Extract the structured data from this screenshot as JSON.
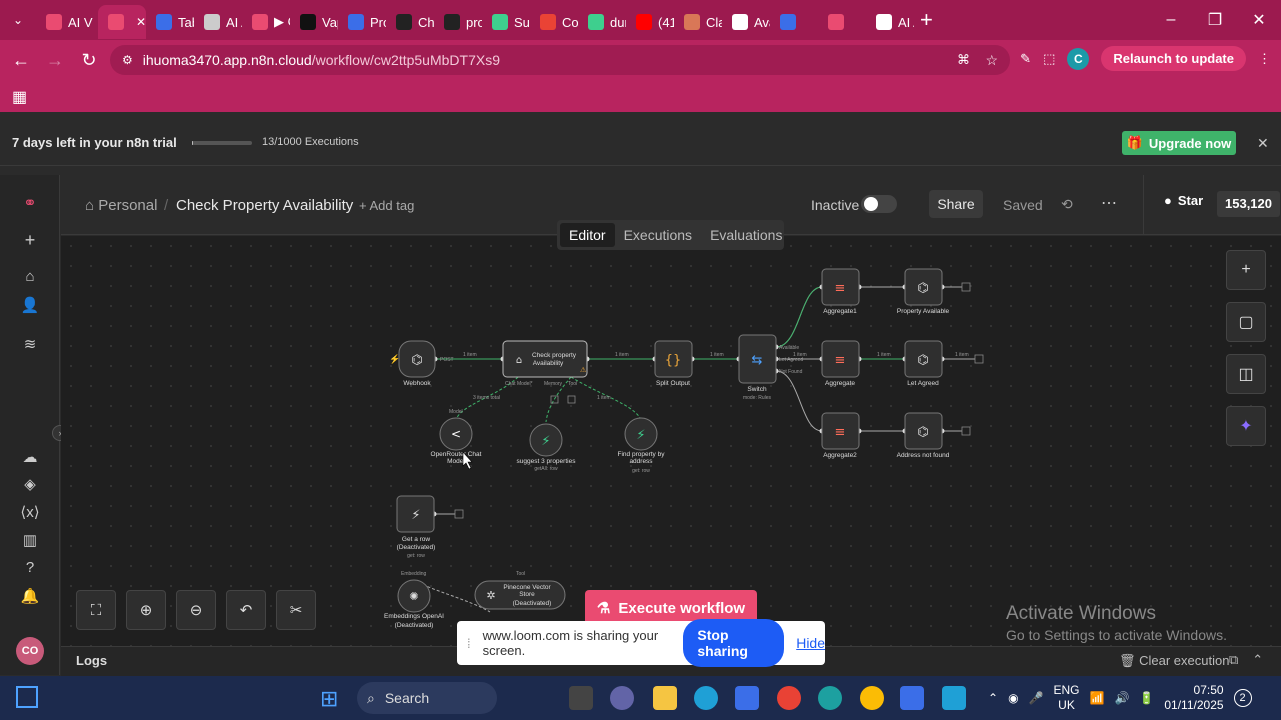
{
  "browser": {
    "tabs": [
      {
        "label": "AI V",
        "color": "#ea4b71"
      },
      {
        "label": "",
        "color": "#ea4b71",
        "active": true
      },
      {
        "label": "Tab",
        "color": "#3b6ee8"
      },
      {
        "label": "AI A",
        "color": "#cccccc"
      },
      {
        "label": "▶ C",
        "color": "#ea4b71"
      },
      {
        "label": "Vap",
        "color": "#111111"
      },
      {
        "label": "Pro",
        "color": "#3b6ee8"
      },
      {
        "label": "Ch",
        "color": "#222222"
      },
      {
        "label": "pro",
        "color": "#222222"
      },
      {
        "label": "Sup",
        "color": "#3ecf8e"
      },
      {
        "label": "Co",
        "color": "#ea4335"
      },
      {
        "label": "dur",
        "color": "#3ecf8e"
      },
      {
        "label": "(41",
        "color": "#ff0000"
      },
      {
        "label": "Cla",
        "color": "#d97757"
      },
      {
        "label": "Ava",
        "color": "#ffffff"
      },
      {
        "label": "",
        "color": "#3b6ee8"
      },
      {
        "label": "",
        "color": "#ea4b71"
      },
      {
        "label": "AI A",
        "color": "#ffffff"
      }
    ],
    "url_host": "ihuoma3470.app.n8n.cloud",
    "url_path": "/workflow/cw2ttp5uMbDT7Xs9",
    "relaunch_label": "Relaunch to update",
    "profile_initial": "C"
  },
  "trial": {
    "text": "7 days left in your n8n trial",
    "executions": "13/1000 Executions",
    "progress_fraction": 0.013,
    "upgrade_label": "Upgrade now"
  },
  "header": {
    "project": "Personal",
    "workflow_title": "Check Property Availability",
    "add_tag": "+ Add tag",
    "active_state": "Inactive",
    "share_label": "Share",
    "saved_label": "Saved"
  },
  "github": {
    "star_label": "Star",
    "star_count": "153,120"
  },
  "view_tabs": [
    "Editor",
    "Executions",
    "Evaluations"
  ],
  "nodes": {
    "webhook": "Webhook",
    "check_line1": "Check property",
    "check_line2": "Availability",
    "openrouter_line1": "OpenRouter Chat",
    "openrouter_line2": "Model",
    "suggest": "suggest 3 properties",
    "suggest_sub": "getAll: row",
    "find_line1": "Find property by",
    "find_line2": "address",
    "find_sub": "get: row",
    "split": "Split Output",
    "switch": "Switch",
    "switch_sub": "mode: Rules",
    "aggregate1": "Aggregate1",
    "aggregate": "Aggregate",
    "aggregate2": "Aggregate2",
    "property_available": "Property Available",
    "let_agreed": "Let Agreed",
    "address_not_found": "Address not found",
    "get_row_line1": "Get a row",
    "get_row_line2": "(Deactivated)",
    "get_row_sub": "get: row",
    "embeddings_line1": "Embeddings OpenAI",
    "embeddings_line2": "(Deactivated)",
    "pinecone_line1": "Pinecone Vector",
    "pinecone_line2": "Store",
    "pinecone_line3": "(Deactivated)"
  },
  "edges": {
    "post": "POST",
    "one_item": "1 item",
    "three_items": "3 items total",
    "chat_model": "Chat Model*",
    "memory": "Memory",
    "tool": "Tool",
    "model": "Model",
    "available": "Available",
    "let_agreed": "Let Agreed",
    "not_found": "Not Found",
    "embedding": "Embedding",
    "tool_small": "Tool"
  },
  "canvas": {
    "execute_label": "Execute workflow",
    "watermark_title": "Activate Windows",
    "watermark_sub": "Go to Settings to activate Windows."
  },
  "loom": {
    "text": "www.loom.com is sharing your screen.",
    "stop_label": "Stop sharing",
    "hide_label": "Hide"
  },
  "logs": {
    "label": "Logs",
    "clear_label": "Clear execution"
  },
  "taskbar": {
    "search_label": "Search",
    "lang_line1": "ENG",
    "lang_line2": "UK",
    "time": "07:50",
    "date": "01/11/2025",
    "notif_count": "2"
  },
  "colors": {
    "brand": "#ea4b71",
    "chrome": "#b8245f",
    "upgrade": "#3fb36a",
    "loom_blue": "#1d5cf5"
  }
}
